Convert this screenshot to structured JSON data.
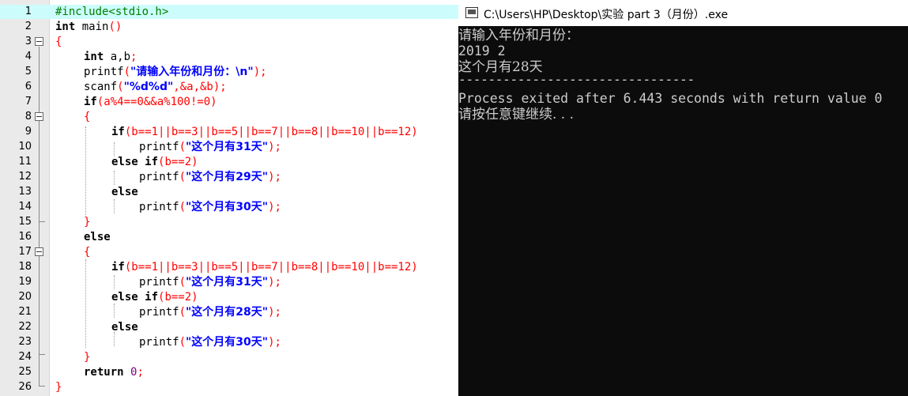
{
  "editor": {
    "line_numbers": [
      "1",
      "2",
      "3",
      "4",
      "5",
      "6",
      "7",
      "8",
      "9",
      "10",
      "11",
      "12",
      "13",
      "14",
      "15",
      "16",
      "17",
      "18",
      "19",
      "20",
      "21",
      "22",
      "23",
      "24",
      "25",
      "26"
    ],
    "code": {
      "l1": "#include<stdio.h>",
      "l2_kw": "int",
      "l2_rest": " main",
      "l2_paren": "()",
      "l3": "{",
      "l4_kw": "int",
      "l4_rest": " a,b",
      "l4_semi": ";",
      "l5_fn": "printf",
      "l5_p": "(",
      "l5_str": "\"请输入年份和月份：\\n\"",
      "l5_end": ");",
      "l6_fn": "scanf",
      "l6_p": "(",
      "l6_str": "\"%d%d\"",
      "l6_args": ",&a,&b",
      "l6_end": ");",
      "l7_kw": "if",
      "l7_cond": "(a%4==0&&a%100!=0)",
      "l8": "{",
      "l9_kw": "if",
      "l9_cond": "(b==1||b==3||b==5||b==7||b==8||b==10||b==12)",
      "l10_fn": "printf",
      "l10_p": "(",
      "l10_str": "\"这个月有31天\"",
      "l10_end": ");",
      "l11_kw": "else if",
      "l11_cond": "(b==2)",
      "l12_fn": "printf",
      "l12_p": "(",
      "l12_str": "\"这个月有29天\"",
      "l12_end": ");",
      "l13_kw": "else",
      "l14_fn": "printf",
      "l14_p": "(",
      "l14_str": "\"这个月有30天\"",
      "l14_end": ");",
      "l15": "}",
      "l16_kw": "else",
      "l17": "{",
      "l18_kw": "if",
      "l18_cond": "(b==1||b==3||b==5||b==7||b==8||b==10||b==12)",
      "l19_fn": "printf",
      "l19_p": "(",
      "l19_str": "\"这个月有31天\"",
      "l19_end": ");",
      "l20_kw": "else if",
      "l20_cond": "(b==2)",
      "l21_fn": "printf",
      "l21_p": "(",
      "l21_str": "\"这个月有28天\"",
      "l21_end": ");",
      "l22_kw": "else",
      "l23_fn": "printf",
      "l23_p": "(",
      "l23_str": "\"这个月有30天\"",
      "l23_end": ");",
      "l24": "}",
      "l25_kw": "return",
      "l25_num": " 0",
      "l25_semi": ";",
      "l26": "}"
    },
    "colors": {
      "current_line": "#ccfcfc",
      "keyword": "#000000",
      "preprocessor": "#008000",
      "string": "#0000ff",
      "operator": "#ff0000",
      "number": "#800080"
    }
  },
  "console": {
    "title": "C:\\Users\\HP\\Desktop\\实验 part 3（月份）.exe",
    "icon": "console-window-icon",
    "lines": [
      "请输入年份和月份：",
      "2019 2",
      "这个月有28天",
      "--------------------------------",
      "Process exited after 6.443 seconds with return value 0",
      "请按任意键继续. . ."
    ]
  }
}
